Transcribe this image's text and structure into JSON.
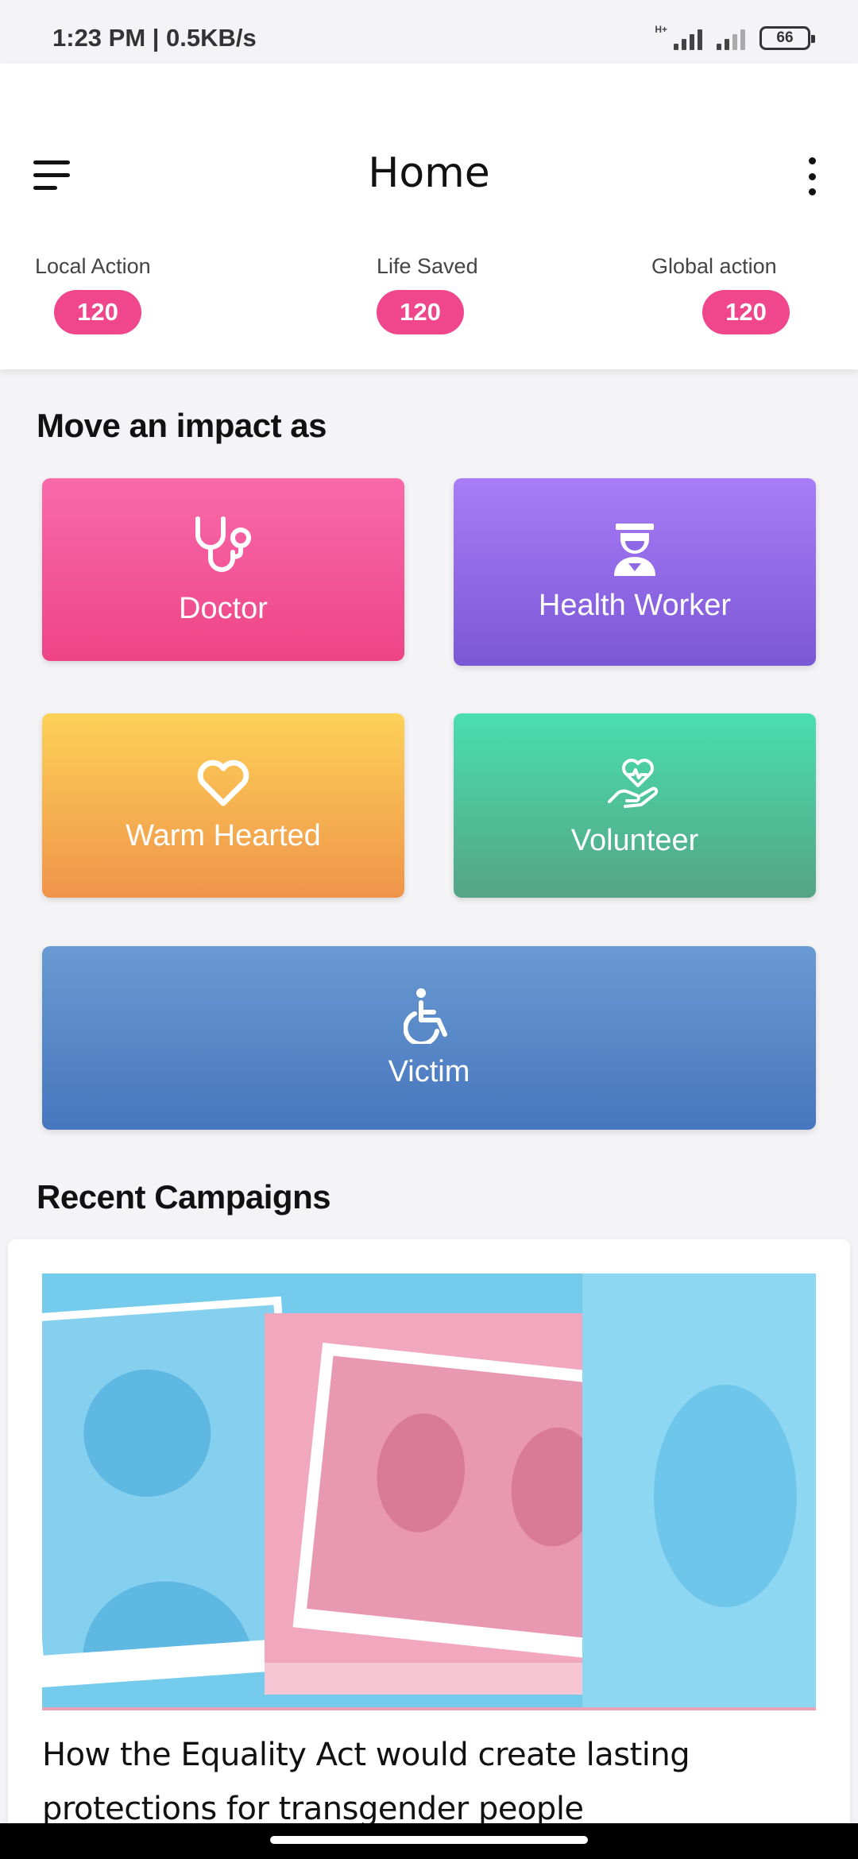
{
  "status_bar": {
    "time": "1:23 PM | 0.5KB/s",
    "network_type": "H+",
    "battery": "66"
  },
  "header": {
    "title": "Home",
    "menu_icon": "hamburger-menu-icon",
    "more_icon": "more-vertical-icon"
  },
  "stats": [
    {
      "label": "Local Action",
      "value": "120"
    },
    {
      "label": "Life Saved",
      "value": "120"
    },
    {
      "label": "Global action",
      "value": "120"
    }
  ],
  "impact": {
    "title": "Move an impact as",
    "tiles": [
      {
        "label": "Doctor",
        "icon": "stethoscope-icon",
        "color": "#f05a98"
      },
      {
        "label": "Health Worker",
        "icon": "health-worker-icon",
        "color": "#8f68e6"
      },
      {
        "label": "Warm Hearted",
        "icon": "heart-icon",
        "color": "#f6b450"
      },
      {
        "label": "Volunteer",
        "icon": "hand-heart-icon",
        "color": "#4fc79c"
      },
      {
        "label": "Victim",
        "icon": "wheelchair-icon",
        "color": "#5887c7"
      }
    ]
  },
  "campaigns": {
    "title": "Recent Campaigns",
    "items": [
      {
        "title": "How the Equality Act would create lasting protections for transgender people",
        "image": "collage-photo"
      }
    ]
  },
  "colors": {
    "accent": "#f0468c",
    "background": "#f4f4f6"
  }
}
